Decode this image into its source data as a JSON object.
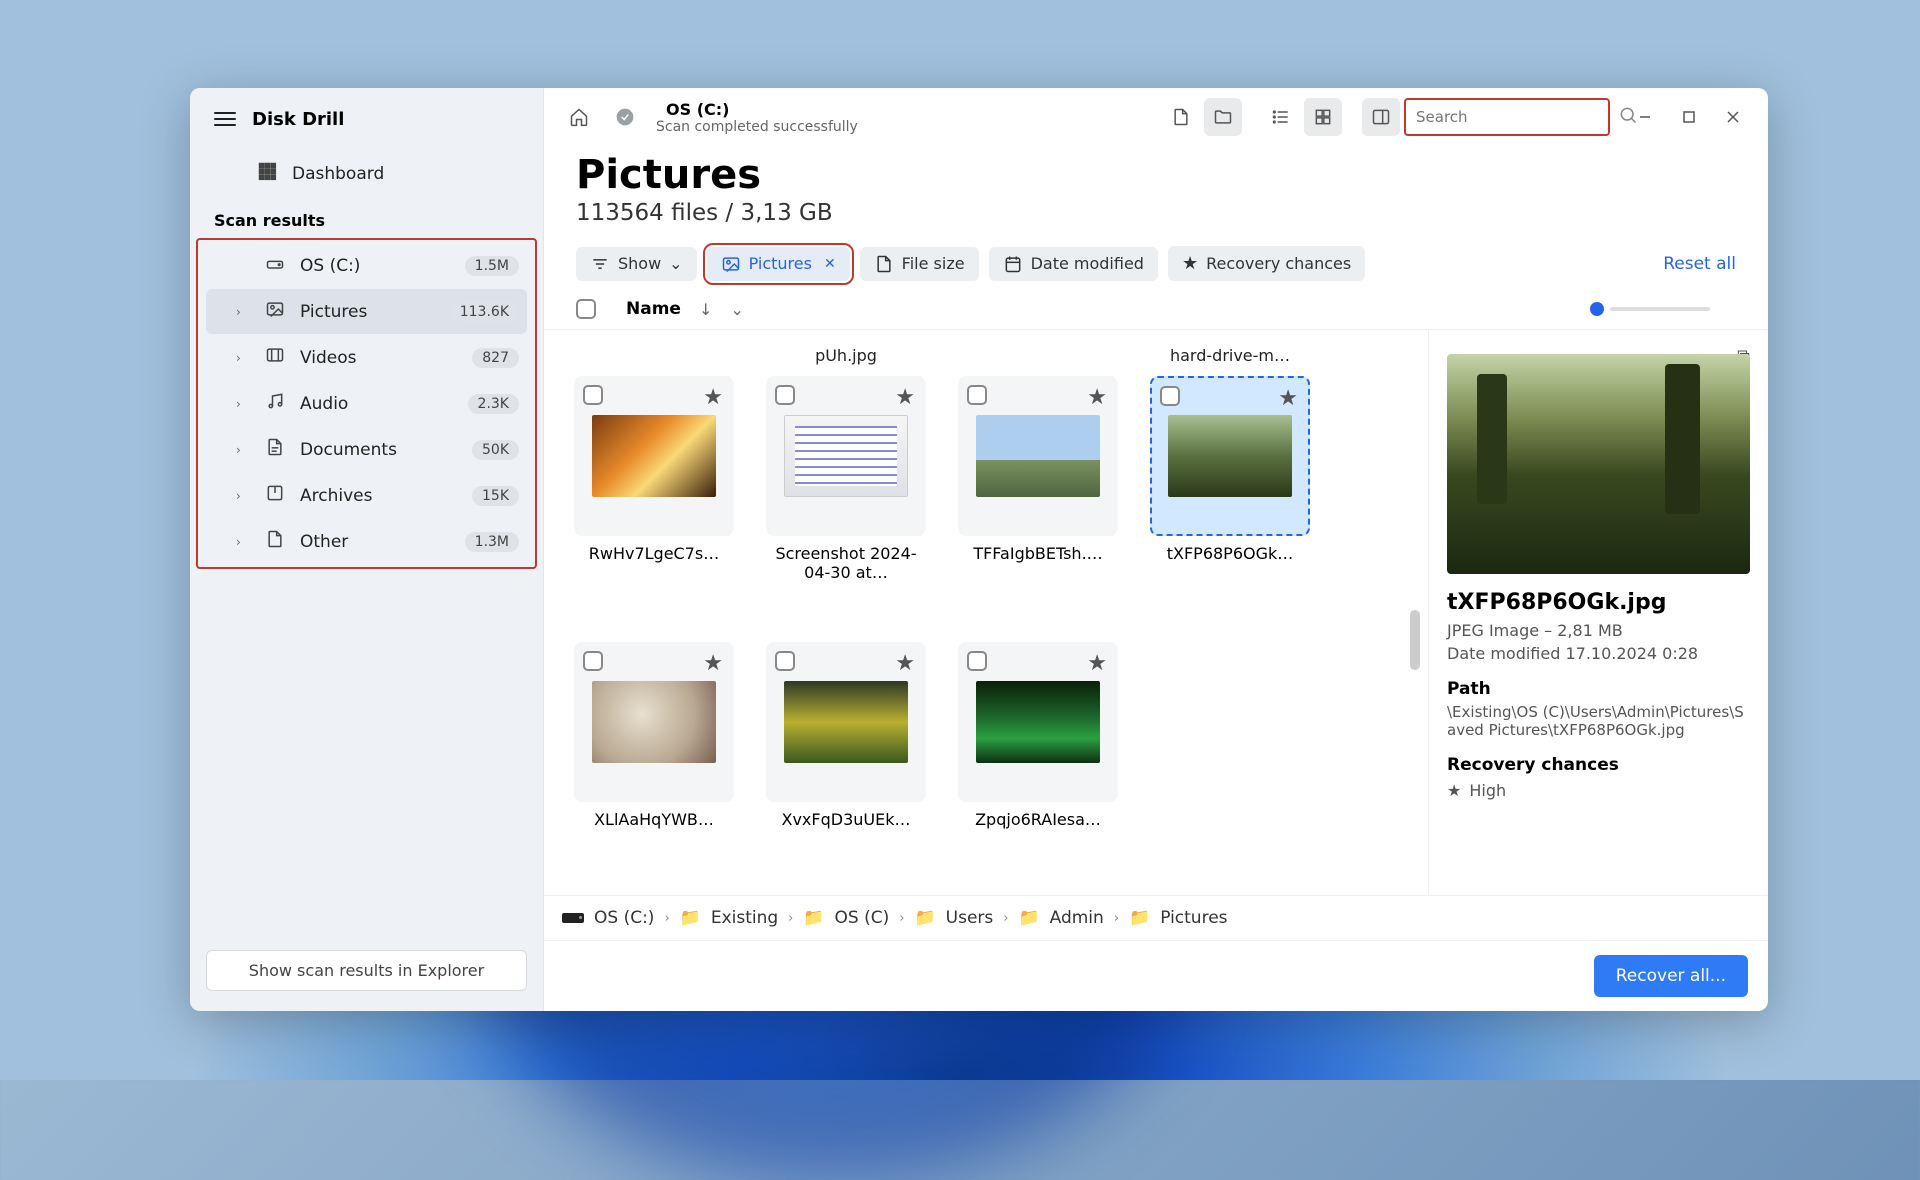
{
  "app_name": "Disk Drill",
  "sidebar": {
    "dashboard": "Dashboard",
    "heading": "Scan results",
    "items": [
      {
        "icon": "drive",
        "label": "OS (C:)",
        "count": "1.5M"
      },
      {
        "icon": "image",
        "label": "Pictures",
        "count": "113.6K",
        "active": true
      },
      {
        "icon": "video",
        "label": "Videos",
        "count": "827"
      },
      {
        "icon": "audio",
        "label": "Audio",
        "count": "2.3K"
      },
      {
        "icon": "doc",
        "label": "Documents",
        "count": "50K"
      },
      {
        "icon": "archive",
        "label": "Archives",
        "count": "15K"
      },
      {
        "icon": "other",
        "label": "Other",
        "count": "1.3M"
      }
    ],
    "explorer_button": "Show scan results in Explorer"
  },
  "topbar": {
    "title": "OS (C:)",
    "subtitle": "Scan completed successfully",
    "search_placeholder": "Search"
  },
  "heading": {
    "title": "Pictures",
    "subtitle": "113564 files / 3,13 GB"
  },
  "filters": {
    "show": "Show",
    "pictures": "Pictures",
    "filesize": "File size",
    "datemod": "Date modified",
    "recovery": "Recovery chances",
    "reset": "Reset all"
  },
  "columns": {
    "name": "Name"
  },
  "grid": [
    {
      "top": "",
      "name": "RwHv7LgeC7s…",
      "thumb": "t1"
    },
    {
      "top": "pUh.jpg",
      "name": "Screenshot 2024-04-30 at…",
      "thumb": "t2"
    },
    {
      "top": "",
      "name": "TFFaIgbBETsh.…",
      "thumb": "t3"
    },
    {
      "top": "hard-drive-m…",
      "name": "tXFP68P6OGk…",
      "thumb": "t4",
      "selected": true
    },
    {
      "top": "",
      "name": "XLlAaHqYWB…",
      "thumb": "t5"
    },
    {
      "top": "",
      "name": "XvxFqD3uUEk…",
      "thumb": "t6"
    },
    {
      "top": "",
      "name": "Zpqjo6RAIesa…",
      "thumb": "t7"
    }
  ],
  "details": {
    "name": "tXFP68P6OGk.jpg",
    "meta": "JPEG Image – 2,81 MB",
    "modified": "Date modified 17.10.2024 0:28",
    "path_h": "Path",
    "path": "\\Existing\\OS (C)\\Users\\Admin\\Pictures\\Saved Pictures\\tXFP68P6OGk.jpg",
    "rc_h": "Recovery chances",
    "rc_v": "High"
  },
  "breadcrumbs": [
    "OS (C:)",
    "Existing",
    "OS (C)",
    "Users",
    "Admin",
    "Pictures"
  ],
  "footer": {
    "recover": "Recover all..."
  }
}
